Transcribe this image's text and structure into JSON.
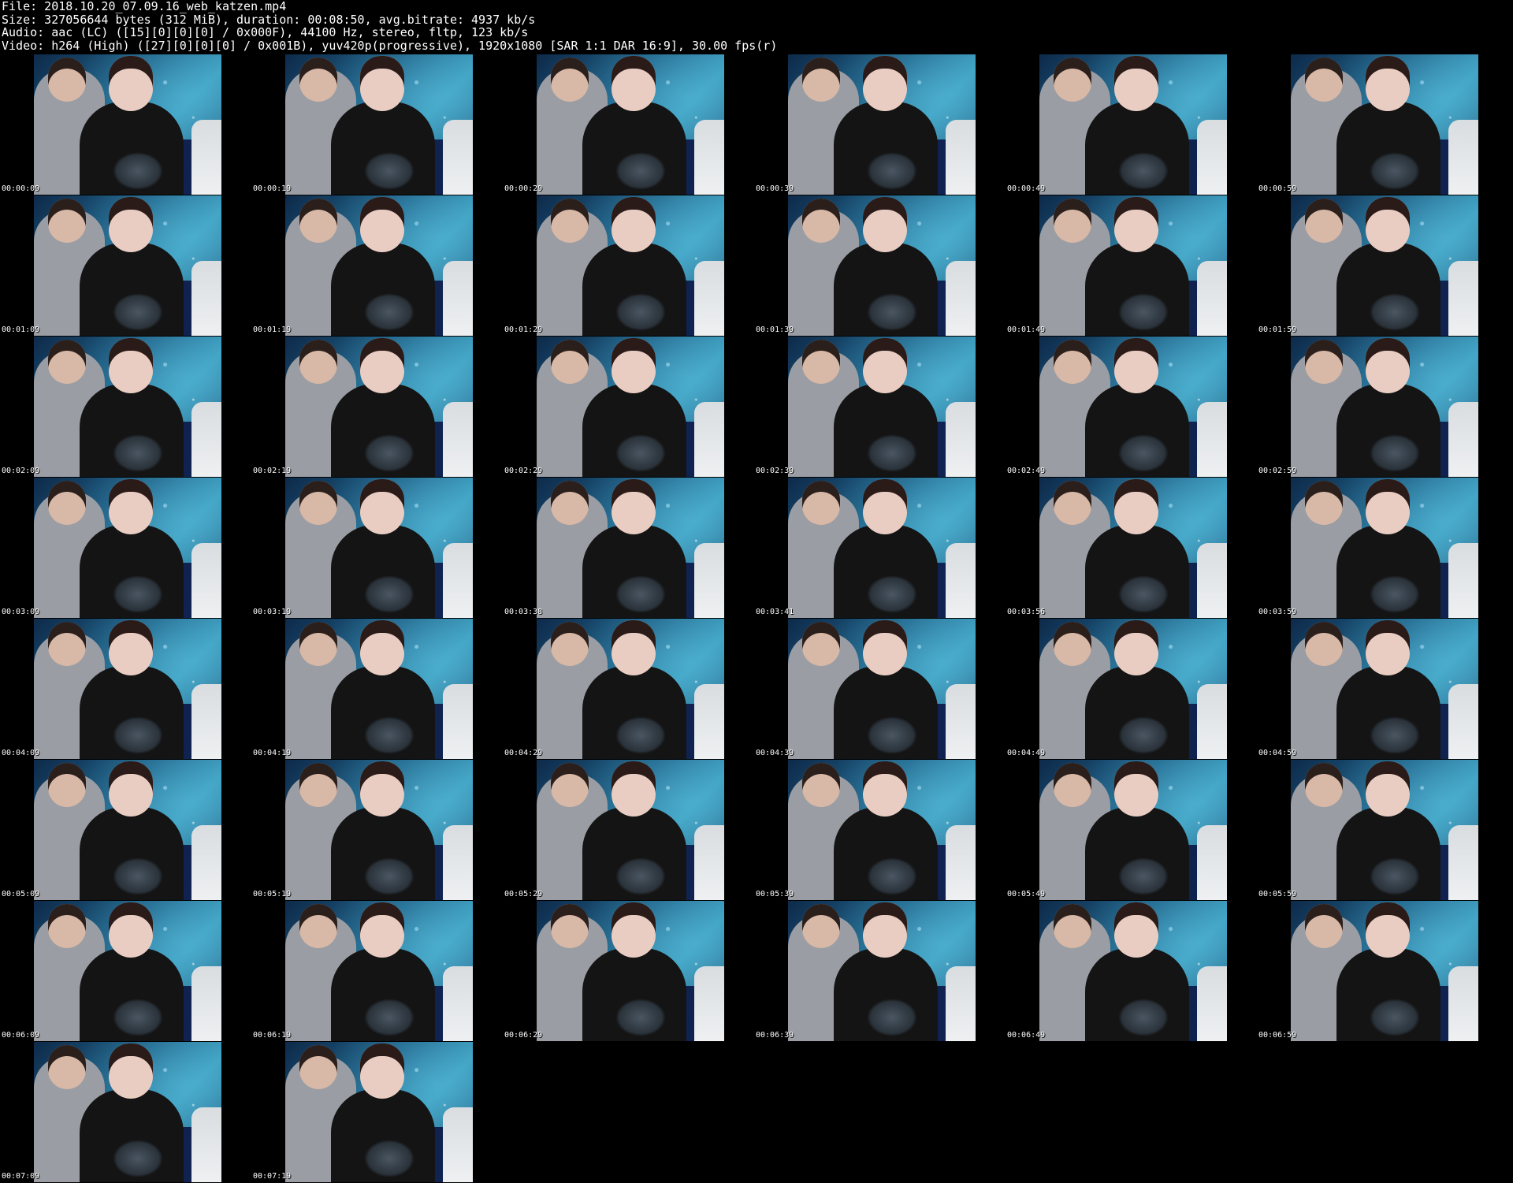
{
  "header": {
    "file_line": "File: 2018.10.20_07.09.16_web_katzen.mp4",
    "size_line": "Size: 327056644 bytes (312 MiB), duration: 00:08:50, avg.bitrate: 4937 kb/s",
    "audio_line": "Audio: aac (LC) ([15][0][0][0] / 0x000F), 44100 Hz, stereo, fltp, 123 kb/s",
    "video_line": "Video: h264 (High) ([27][0][0][0] / 0x001B), yuv420p(progressive), 1920x1080 [SAR 1:1 DAR 16:9], 30.00 fps(r)"
  },
  "frames": [
    {
      "time": "00:00:09"
    },
    {
      "time": "00:00:19"
    },
    {
      "time": "00:00:29"
    },
    {
      "time": "00:00:39"
    },
    {
      "time": "00:00:49"
    },
    {
      "time": "00:00:59"
    },
    {
      "time": "00:01:09"
    },
    {
      "time": "00:01:19"
    },
    {
      "time": "00:01:29"
    },
    {
      "time": "00:01:39"
    },
    {
      "time": "00:01:49"
    },
    {
      "time": "00:01:59"
    },
    {
      "time": "00:02:09"
    },
    {
      "time": "00:02:19"
    },
    {
      "time": "00:02:29"
    },
    {
      "time": "00:02:39"
    },
    {
      "time": "00:02:49"
    },
    {
      "time": "00:02:59"
    },
    {
      "time": "00:03:09"
    },
    {
      "time": "00:03:19"
    },
    {
      "time": "00:03:38"
    },
    {
      "time": "00:03:41"
    },
    {
      "time": "00:03:56"
    },
    {
      "time": "00:03:59"
    },
    {
      "time": "00:04:09"
    },
    {
      "time": "00:04:19"
    },
    {
      "time": "00:04:29"
    },
    {
      "time": "00:04:39"
    },
    {
      "time": "00:04:49"
    },
    {
      "time": "00:04:59"
    },
    {
      "time": "00:05:09"
    },
    {
      "time": "00:05:19"
    },
    {
      "time": "00:05:29"
    },
    {
      "time": "00:05:39"
    },
    {
      "time": "00:05:49"
    },
    {
      "time": "00:05:59"
    },
    {
      "time": "00:06:09"
    },
    {
      "time": "00:06:19"
    },
    {
      "time": "00:06:29"
    },
    {
      "time": "00:06:39"
    },
    {
      "time": "00:06:49"
    },
    {
      "time": "00:06:59"
    },
    {
      "time": "00:07:09"
    },
    {
      "time": "00:07:19"
    }
  ]
}
